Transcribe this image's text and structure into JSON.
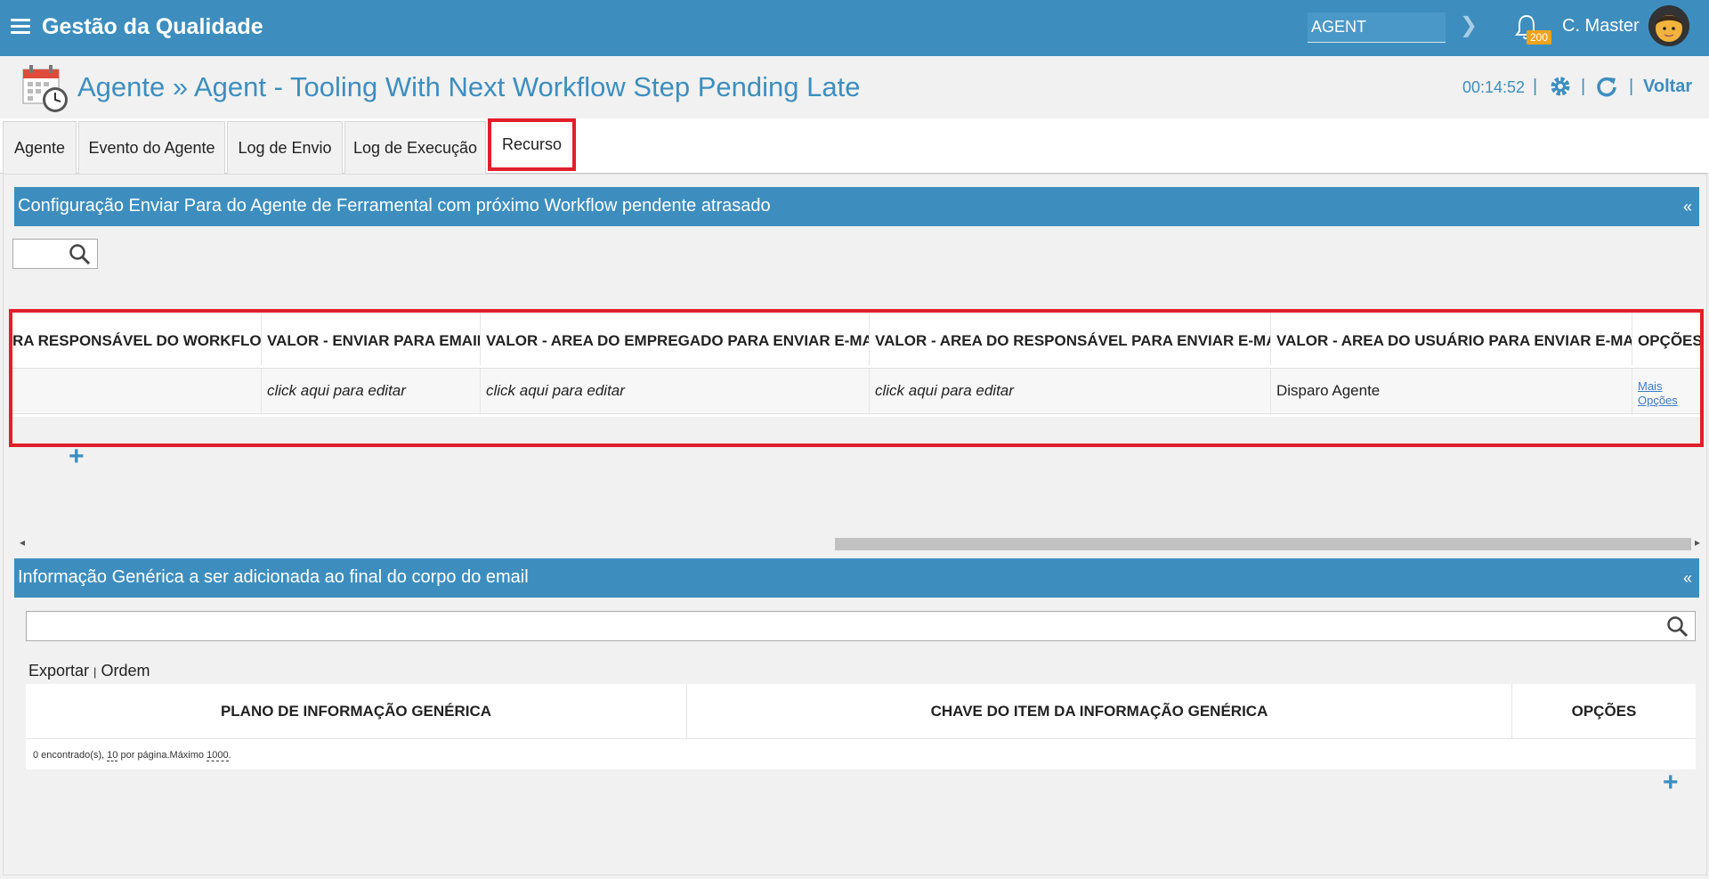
{
  "topbar": {
    "app_title": "Gestão da Qualidade",
    "search_value": "AGENT",
    "notification_count": "200",
    "user_name": "C. Master",
    "bg_color": "#3d8ebf"
  },
  "header": {
    "title": "Agente » Agent - Tooling With Next Workflow Step Pending Late",
    "timer": "00:14:52",
    "back_label": "Voltar"
  },
  "tabs": [
    {
      "label": "Agente"
    },
    {
      "label": "Evento do Agente"
    },
    {
      "label": "Log de Envio"
    },
    {
      "label": "Log de Execução"
    },
    {
      "label": "Recurso",
      "active": true
    }
  ],
  "section1": {
    "title": "Configuração Enviar Para do Agente de Ferramental com próximo Workflow pendente atrasado",
    "collapse": "«",
    "columns": [
      "RA RESPONSÁVEL DO WORKFLOW",
      "VALOR - ENVIAR PARA EMAIL",
      "VALOR - AREA DO EMPREGADO PARA ENVIAR E-MAIL",
      "VALOR - AREA DO RESPONSÁVEL PARA ENVIAR E-MAIL",
      "VALOR - AREA DO USUÁRIO PARA ENVIAR E-MAIL",
      "OPÇÕES"
    ],
    "row": [
      "",
      "click aqui para editar",
      "click aqui para editar",
      "click aqui para editar",
      "Disparo Agente"
    ],
    "more_options_1": "Mais",
    "more_options_2": "Opções"
  },
  "section2": {
    "title": "Informação Genérica a ser adicionada ao final do corpo do email",
    "collapse": "«",
    "export_label": "Exportar",
    "separator": "|",
    "order_label": "Ordem",
    "columns": [
      "PLANO DE INFORMAÇÃO GENÉRICA",
      "CHAVE DO ITEM DA INFORMAÇÃO GENÉRICA",
      "OPÇÕES"
    ],
    "footer_found": "0 encontrado(s),",
    "footer_per_page_value": "10",
    "footer_per_page_label": "por página.Máximo",
    "footer_max_value": "1000",
    "footer_end": "."
  }
}
